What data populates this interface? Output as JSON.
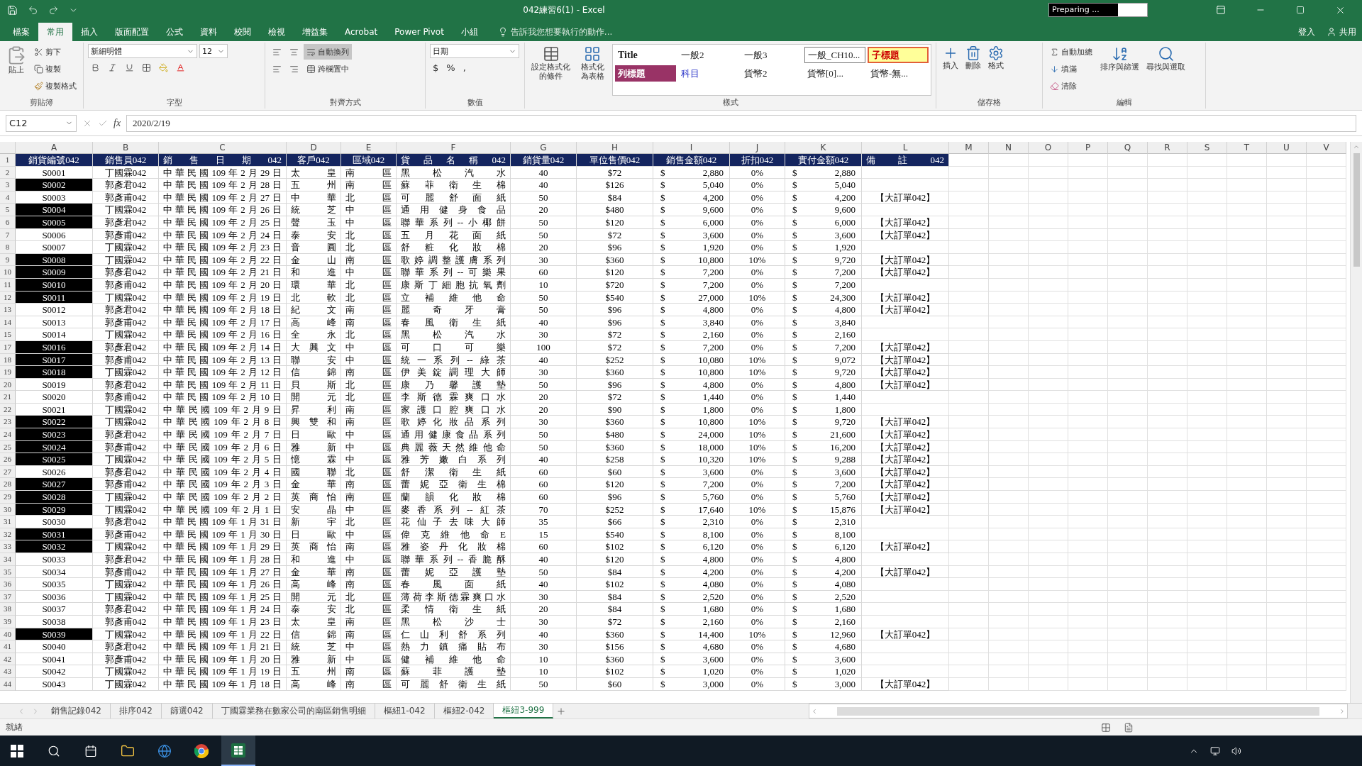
{
  "window": {
    "title": "042練習6(1) - Excel",
    "progress": {
      "label": "Preparing ...",
      "level": 0.7
    }
  },
  "menu_tabs": [
    {
      "label": "檔案",
      "selected": false
    },
    {
      "label": "常用",
      "selected": true
    },
    {
      "label": "插入",
      "selected": false
    },
    {
      "label": "版面配置",
      "selected": false
    },
    {
      "label": "公式",
      "selected": false
    },
    {
      "label": "資料",
      "selected": false
    },
    {
      "label": "校閱",
      "selected": false
    },
    {
      "label": "檢視",
      "selected": false
    },
    {
      "label": "增益集",
      "selected": false
    },
    {
      "label": "Acrobat",
      "selected": false
    },
    {
      "label": "Power Pivot",
      "selected": false
    },
    {
      "label": "小組",
      "selected": false
    }
  ],
  "tell_me": "告訴我您想要執行的動作...",
  "sign_in": "登入",
  "share": "共用",
  "ribbon": {
    "clipboard": {
      "label": "剪貼簿",
      "paste": "貼上",
      "cut": "剪下",
      "copy": "複製",
      "format_painter": "複製格式"
    },
    "font": {
      "label": "字型",
      "name": "新細明體",
      "size": "12"
    },
    "alignment": {
      "label": "對齊方式",
      "wrap": "自動換列",
      "wrap_on": true,
      "merge": "跨欄置中"
    },
    "number": {
      "label": "數值",
      "format": "日期",
      "symbols": [
        "$",
        "%",
        ","
      ]
    },
    "styles": {
      "label": "樣式",
      "conditional": "設定格式化的條件",
      "as_table": "格式化為表格",
      "gallery": [
        {
          "label": "Title",
          "kind": "title"
        },
        {
          "label": "一般2",
          "kind": "plain"
        },
        {
          "label": "一般3",
          "kind": "plain"
        },
        {
          "label": "一般_CH10...",
          "kind": "outlined"
        },
        {
          "label": "子標題",
          "kind": "subtitle"
        },
        {
          "label": "列標題",
          "kind": "header"
        },
        {
          "label": "科目",
          "kind": "subject"
        },
        {
          "label": "貨幣2",
          "kind": "plain"
        },
        {
          "label": "貨幣[0]...",
          "kind": "plain"
        },
        {
          "label": "貨幣-無...",
          "kind": "plain"
        }
      ]
    },
    "cells": {
      "label": "儲存格",
      "buttons": [
        "插入",
        "刪除",
        "格式"
      ]
    },
    "editing": {
      "label": "編輯",
      "autosum": "自動加總",
      "fill": "填滿",
      "clear": "清除",
      "sort": "排序與篩選",
      "find": "尋找與選取"
    }
  },
  "formula_bar": {
    "name_box": "C12",
    "function_label": "fx",
    "value": "2020/2/19"
  },
  "columns": [
    "A",
    "B",
    "C",
    "D",
    "E",
    "F",
    "G",
    "H",
    "I",
    "J",
    "K",
    "L",
    "M",
    "N",
    "O",
    "P",
    "Q",
    "R",
    "S",
    "T",
    "U",
    "V"
  ],
  "header_row_number": "1",
  "headers": [
    "銷貨編號042",
    "銷售員042",
    "銷售日期042",
    "客戶042",
    "區域042",
    "貨品名稱042",
    "銷貨量042",
    "單位售價042",
    "銷售金額042",
    "折扣042",
    "實付金額042",
    "備註042"
  ],
  "rows": [
    {
      "n": "2",
      "id": "S0001",
      "highlighted": false,
      "seller": "丁國霖042",
      "date": "中華民國109年2月29日",
      "customer": "太皇",
      "region": "南區",
      "product": "黑松汽水",
      "qty": "40",
      "price": "$72",
      "amount": [
        "$",
        "2,880"
      ],
      "discount": "0%",
      "paid": [
        "$",
        "2,880"
      ]
    },
    {
      "n": "3",
      "id": "S0002",
      "highlighted": true,
      "seller": "郭彥君042",
      "date": "中華民國109年2月28日",
      "customer": "五州",
      "region": "南區",
      "product": "蘇菲衛生棉",
      "qty": "40",
      "price": "$126",
      "amount": [
        "$",
        "5,040"
      ],
      "discount": "0%",
      "paid": [
        "$",
        "5,040"
      ]
    },
    {
      "n": "4",
      "id": "S0003",
      "highlighted": false,
      "seller": "郭彥甫042",
      "date": "中華民國109年2月27日",
      "customer": "中華",
      "region": "北區",
      "product": "可麗舒面紙",
      "qty": "50",
      "price": "$84",
      "amount": [
        "$",
        "4,200"
      ],
      "discount": "0%",
      "paid": [
        "$",
        "4,200"
      ],
      "note": "【大訂單042】"
    },
    {
      "n": "5",
      "id": "S0004",
      "highlighted": true,
      "seller": "丁國霖042",
      "date": "中華民國109年2月26日",
      "customer": "統芝",
      "region": "中區",
      "product": "通用健身食品",
      "qty": "20",
      "price": "$480",
      "amount": [
        "$",
        "9,600"
      ],
      "discount": "0%",
      "paid": [
        "$",
        "9,600"
      ]
    },
    {
      "n": "6",
      "id": "S0005",
      "highlighted": true,
      "seller": "郭彥君042",
      "date": "中華民國109年2月25日",
      "customer": "聲玉",
      "region": "中區",
      "product": "聯華系列--小椰餅",
      "qty": "50",
      "price": "$120",
      "amount": [
        "$",
        "6,000"
      ],
      "discount": "0%",
      "paid": [
        "$",
        "6,000"
      ],
      "note": "【大訂單042】"
    },
    {
      "n": "7",
      "id": "S0006",
      "highlighted": false,
      "seller": "郭彥甫042",
      "date": "中華民國109年2月24日",
      "customer": "泰安",
      "region": "北區",
      "product": "五月花面紙",
      "qty": "50",
      "price": "$72",
      "amount": [
        "$",
        "3,600"
      ],
      "discount": "0%",
      "paid": [
        "$",
        "3,600"
      ],
      "note": "【大訂單042】"
    },
    {
      "n": "8",
      "id": "S0007",
      "highlighted": false,
      "seller": "丁國霖042",
      "date": "中華民國109年2月23日",
      "customer": "音圓",
      "region": "北區",
      "product": "舒粧化妝棉",
      "qty": "20",
      "price": "$96",
      "amount": [
        "$",
        "1,920"
      ],
      "discount": "0%",
      "paid": [
        "$",
        "1,920"
      ]
    },
    {
      "n": "9",
      "id": "S0008",
      "highlighted": true,
      "seller": "丁國霖042",
      "date": "中華民國109年2月22日",
      "customer": "金山",
      "region": "南區",
      "product": "歌婷調整護膚系列",
      "qty": "30",
      "price": "$360",
      "amount": [
        "$",
        "10,800"
      ],
      "discount": "10%",
      "paid": [
        "$",
        "9,720"
      ],
      "note": "【大訂單042】"
    },
    {
      "n": "10",
      "id": "S0009",
      "highlighted": true,
      "seller": "郭彥君042",
      "date": "中華民國109年2月21日",
      "customer": "和進",
      "region": "中區",
      "product": "聯華系列--可樂果",
      "qty": "60",
      "price": "$120",
      "amount": [
        "$",
        "7,200"
      ],
      "discount": "0%",
      "paid": [
        "$",
        "7,200"
      ],
      "note": "【大訂單042】"
    },
    {
      "n": "11",
      "id": "S0010",
      "highlighted": true,
      "seller": "郭彥甫042",
      "date": "中華民國109年2月20日",
      "customer": "環華",
      "region": "北區",
      "product": "康斯丁細胞抗氧劑",
      "qty": "10",
      "price": "$720",
      "amount": [
        "$",
        "7,200"
      ],
      "discount": "0%",
      "paid": [
        "$",
        "7,200"
      ]
    },
    {
      "n": "12",
      "id": "S0011",
      "highlighted": true,
      "seller": "丁國霖042",
      "date": "中華民國109年2月19日",
      "customer": "北軟",
      "region": "北區",
      "product": "立補維他命",
      "qty": "50",
      "price": "$540",
      "amount": [
        "$",
        "27,000"
      ],
      "discount": "10%",
      "paid": [
        "$",
        "24,300"
      ],
      "note": "【大訂單042】"
    },
    {
      "n": "13",
      "id": "S0012",
      "highlighted": false,
      "seller": "郭彥君042",
      "date": "中華民國109年2月18日",
      "customer": "紀文",
      "region": "南區",
      "product": "麗奇牙膏",
      "qty": "50",
      "price": "$96",
      "amount": [
        "$",
        "4,800"
      ],
      "discount": "0%",
      "paid": [
        "$",
        "4,800"
      ],
      "note": "【大訂單042】"
    },
    {
      "n": "14",
      "id": "S0013",
      "highlighted": false,
      "seller": "郭彥甫042",
      "date": "中華民國109年2月17日",
      "customer": "高峰",
      "region": "南區",
      "product": "春風衛生紙",
      "qty": "40",
      "price": "$96",
      "amount": [
        "$",
        "3,840"
      ],
      "discount": "0%",
      "paid": [
        "$",
        "3,840"
      ]
    },
    {
      "n": "15",
      "id": "S0014",
      "highlighted": false,
      "seller": "丁國霖042",
      "date": "中華民國109年2月16日",
      "customer": "全永",
      "region": "北區",
      "product": "黑松汽水",
      "qty": "30",
      "price": "$72",
      "amount": [
        "$",
        "2,160"
      ],
      "discount": "0%",
      "paid": [
        "$",
        "2,160"
      ]
    },
    {
      "n": "17",
      "id": "S0016",
      "highlighted": true,
      "seller": "郭彥君042",
      "date": "中華民國109年2月14日",
      "customer": "大興文",
      "region": "中區",
      "product": "可口可樂",
      "qty": "100",
      "price": "$72",
      "amount": [
        "$",
        "7,200"
      ],
      "discount": "0%",
      "paid": [
        "$",
        "7,200"
      ],
      "note": "【大訂單042】"
    },
    {
      "n": "18",
      "id": "S0017",
      "highlighted": true,
      "seller": "郭彥甫042",
      "date": "中華民國109年2月13日",
      "customer": "聯安",
      "region": "中區",
      "product": "統一系列--綠茶",
      "qty": "40",
      "price": "$252",
      "amount": [
        "$",
        "10,080"
      ],
      "discount": "10%",
      "paid": [
        "$",
        "9,072"
      ],
      "note": "【大訂單042】"
    },
    {
      "n": "19",
      "id": "S0018",
      "highlighted": true,
      "seller": "丁國霖042",
      "date": "中華民國109年2月12日",
      "customer": "信錦",
      "region": "南區",
      "product": "伊美錠調理大師",
      "qty": "30",
      "price": "$360",
      "amount": [
        "$",
        "10,800"
      ],
      "discount": "10%",
      "paid": [
        "$",
        "9,720"
      ],
      "note": "【大訂單042】"
    },
    {
      "n": "20",
      "id": "S0019",
      "highlighted": false,
      "seller": "郭彥君042",
      "date": "中華民國109年2月11日",
      "customer": "貝斯",
      "region": "北區",
      "product": "康乃馨護墊",
      "qty": "50",
      "price": "$96",
      "amount": [
        "$",
        "4,800"
      ],
      "discount": "0%",
      "paid": [
        "$",
        "4,800"
      ],
      "note": "【大訂單042】"
    },
    {
      "n": "21",
      "id": "S0020",
      "highlighted": false,
      "seller": "郭彥甫042",
      "date": "中華民國109年2月10日",
      "customer": "開元",
      "region": "北區",
      "product": "李斯德霖爽口水",
      "qty": "20",
      "price": "$72",
      "amount": [
        "$",
        "1,440"
      ],
      "discount": "0%",
      "paid": [
        "$",
        "1,440"
      ]
    },
    {
      "n": "22",
      "id": "S0021",
      "highlighted": false,
      "seller": "丁國霖042",
      "date": "中華民國109年2月9日",
      "customer": "昇利",
      "region": "南區",
      "product": "家護口腔爽口水",
      "qty": "20",
      "price": "$90",
      "amount": [
        "$",
        "1,800"
      ],
      "discount": "0%",
      "paid": [
        "$",
        "1,800"
      ]
    },
    {
      "n": "23",
      "id": "S0022",
      "highlighted": true,
      "seller": "丁國霖042",
      "date": "中華民國109年2月8日",
      "customer": "興雙和",
      "region": "南區",
      "product": "歌婷化妝品系列",
      "qty": "30",
      "price": "$360",
      "amount": [
        "$",
        "10,800"
      ],
      "discount": "10%",
      "paid": [
        "$",
        "9,720"
      ],
      "note": "【大訂單042】"
    },
    {
      "n": "24",
      "id": "S0023",
      "highlighted": true,
      "seller": "郭彥君042",
      "date": "中華民國109年2月7日",
      "customer": "日歐",
      "region": "中區",
      "product": "通用健康食品系列",
      "qty": "50",
      "price": "$480",
      "amount": [
        "$",
        "24,000"
      ],
      "discount": "10%",
      "paid": [
        "$",
        "21,600"
      ],
      "note": "【大訂單042】"
    },
    {
      "n": "25",
      "id": "S0024",
      "highlighted": true,
      "seller": "郭彥甫042",
      "date": "中華民國109年2月6日",
      "customer": "雅新",
      "region": "中區",
      "product": "典麗薇天然維他命",
      "qty": "50",
      "price": "$360",
      "amount": [
        "$",
        "18,000"
      ],
      "discount": "10%",
      "paid": [
        "$",
        "16,200"
      ],
      "note": "【大訂單042】"
    },
    {
      "n": "26",
      "id": "S0025",
      "highlighted": true,
      "seller": "丁國霖042",
      "date": "中華民國109年2月5日",
      "customer": "憶霖",
      "region": "中區",
      "product": "雅芳嫩白系列",
      "qty": "40",
      "price": "$258",
      "amount": [
        "$",
        "10,320"
      ],
      "discount": "10%",
      "paid": [
        "$",
        "9,288"
      ],
      "note": "【大訂單042】"
    },
    {
      "n": "27",
      "id": "S0026",
      "highlighted": false,
      "seller": "郭彥君042",
      "date": "中華民國109年2月4日",
      "customer": "國聯",
      "region": "北區",
      "product": "舒潔衛生紙",
      "qty": "60",
      "price": "$60",
      "amount": [
        "$",
        "3,600"
      ],
      "discount": "0%",
      "paid": [
        "$",
        "3,600"
      ],
      "note": "【大訂單042】"
    },
    {
      "n": "28",
      "id": "S0027",
      "highlighted": true,
      "seller": "郭彥甫042",
      "date": "中華民國109年2月3日",
      "customer": "金華",
      "region": "南區",
      "product": "蕾妮亞衛生棉",
      "qty": "60",
      "price": "$120",
      "amount": [
        "$",
        "7,200"
      ],
      "discount": "0%",
      "paid": [
        "$",
        "7,200"
      ],
      "note": "【大訂單042】"
    },
    {
      "n": "29",
      "id": "S0028",
      "highlighted": true,
      "seller": "丁國霖042",
      "date": "中華民國109年2月2日",
      "customer": "英商怡",
      "region": "南區",
      "product": "蘭韻化妝棉",
      "qty": "60",
      "price": "$96",
      "amount": [
        "$",
        "5,760"
      ],
      "discount": "0%",
      "paid": [
        "$",
        "5,760"
      ],
      "note": "【大訂單042】"
    },
    {
      "n": "30",
      "id": "S0029",
      "highlighted": true,
      "seller": "丁國霖042",
      "date": "中華民國109年2月1日",
      "customer": "安晶",
      "region": "中區",
      "product": "麥香系列--紅茶",
      "qty": "70",
      "price": "$252",
      "amount": [
        "$",
        "17,640"
      ],
      "discount": "10%",
      "paid": [
        "$",
        "15,876"
      ],
      "note": "【大訂單042】"
    },
    {
      "n": "31",
      "id": "S0030",
      "highlighted": false,
      "seller": "郭彥君042",
      "date": "中華民國109年1月31日",
      "customer": "新宇",
      "region": "北區",
      "product": "花仙子去味大師",
      "qty": "35",
      "price": "$66",
      "amount": [
        "$",
        "2,310"
      ],
      "discount": "0%",
      "paid": [
        "$",
        "2,310"
      ]
    },
    {
      "n": "32",
      "id": "S0031",
      "highlighted": true,
      "seller": "郭彥甫042",
      "date": "中華民國109年1月30日",
      "customer": "日歐",
      "region": "中區",
      "product": "偉克維他命E",
      "qty": "15",
      "price": "$540",
      "amount": [
        "$",
        "8,100"
      ],
      "discount": "0%",
      "paid": [
        "$",
        "8,100"
      ]
    },
    {
      "n": "33",
      "id": "S0032",
      "highlighted": true,
      "seller": "丁國霖042",
      "date": "中華民國109年1月29日",
      "customer": "英商怡",
      "region": "南區",
      "product": "雅姿丹化妝棉",
      "qty": "60",
      "price": "$102",
      "amount": [
        "$",
        "6,120"
      ],
      "discount": "0%",
      "paid": [
        "$",
        "6,120"
      ],
      "note": "【大訂單042】"
    },
    {
      "n": "34",
      "id": "S0033",
      "highlighted": false,
      "seller": "郭彥君042",
      "date": "中華民國109年1月28日",
      "customer": "和進",
      "region": "中區",
      "product": "聯華系列--香脆酥",
      "qty": "40",
      "price": "$120",
      "amount": [
        "$",
        "4,800"
      ],
      "discount": "0%",
      "paid": [
        "$",
        "4,800"
      ]
    },
    {
      "n": "35",
      "id": "S0034",
      "highlighted": false,
      "seller": "郭彥甫042",
      "date": "中華民國109年1月27日",
      "customer": "金華",
      "region": "南區",
      "product": "蕾妮亞護墊",
      "qty": "50",
      "price": "$84",
      "amount": [
        "$",
        "4,200"
      ],
      "discount": "0%",
      "paid": [
        "$",
        "4,200"
      ],
      "note": "【大訂單042】"
    },
    {
      "n": "36",
      "id": "S0035",
      "highlighted": false,
      "seller": "丁國霖042",
      "date": "中華民國109年1月26日",
      "customer": "高峰",
      "region": "南區",
      "product": "春風面紙",
      "qty": "40",
      "price": "$102",
      "amount": [
        "$",
        "4,080"
      ],
      "discount": "0%",
      "paid": [
        "$",
        "4,080"
      ]
    },
    {
      "n": "37",
      "id": "S0036",
      "highlighted": false,
      "seller": "丁國霖042",
      "date": "中華民國109年1月25日",
      "customer": "開元",
      "region": "北區",
      "product": "薄荷李斯德霖爽口水",
      "qty": "30",
      "price": "$84",
      "amount": [
        "$",
        "2,520"
      ],
      "discount": "0%",
      "paid": [
        "$",
        "2,520"
      ]
    },
    {
      "n": "38",
      "id": "S0037",
      "highlighted": false,
      "seller": "郭彥君042",
      "date": "中華民國109年1月24日",
      "customer": "泰安",
      "region": "北區",
      "product": "柔情衛生紙",
      "qty": "20",
      "price": "$84",
      "amount": [
        "$",
        "1,680"
      ],
      "discount": "0%",
      "paid": [
        "$",
        "1,680"
      ]
    },
    {
      "n": "39",
      "id": "S0038",
      "highlighted": false,
      "seller": "郭彥甫042",
      "date": "中華民國109年1月23日",
      "customer": "太皇",
      "region": "南區",
      "product": "黑松沙士",
      "qty": "30",
      "price": "$72",
      "amount": [
        "$",
        "2,160"
      ],
      "discount": "0%",
      "paid": [
        "$",
        "2,160"
      ]
    },
    {
      "n": "40",
      "id": "S0039",
      "highlighted": true,
      "seller": "丁國霖042",
      "date": "中華民國109年1月22日",
      "customer": "信錦",
      "region": "南區",
      "product": "仁山利舒系列",
      "qty": "40",
      "price": "$360",
      "amount": [
        "$",
        "14,400"
      ],
      "discount": "10%",
      "paid": [
        "$",
        "12,960"
      ],
      "note": "【大訂單042】"
    },
    {
      "n": "41",
      "id": "S0040",
      "highlighted": false,
      "seller": "郭彥君042",
      "date": "中華民國109年1月21日",
      "customer": "統芝",
      "region": "中區",
      "product": "熱力鎮痛貼布",
      "qty": "30",
      "price": "$156",
      "amount": [
        "$",
        "4,680"
      ],
      "discount": "0%",
      "paid": [
        "$",
        "4,680"
      ]
    },
    {
      "n": "42",
      "id": "S0041",
      "highlighted": false,
      "seller": "郭彥甫042",
      "date": "中華民國109年1月20日",
      "customer": "雅新",
      "region": "中區",
      "product": "健補維他命",
      "qty": "10",
      "price": "$360",
      "amount": [
        "$",
        "3,600"
      ],
      "discount": "0%",
      "paid": [
        "$",
        "3,600"
      ]
    },
    {
      "n": "43",
      "id": "S0042",
      "highlighted": false,
      "seller": "丁國霖042",
      "date": "中華民國109年1月19日",
      "customer": "五州",
      "region": "南區",
      "product": "蘇菲護墊",
      "qty": "10",
      "price": "$102",
      "amount": [
        "$",
        "1,020"
      ],
      "discount": "0%",
      "paid": [
        "$",
        "1,020"
      ]
    },
    {
      "n": "44",
      "id": "S0043",
      "highlighted": false,
      "seller": "丁國霖042",
      "date": "中華民國109年1月18日",
      "customer": "高峰",
      "region": "南區",
      "product": "可麗舒衛生紙",
      "qty": "50",
      "price": "$60",
      "amount": [
        "$",
        "3,000"
      ],
      "discount": "0%",
      "paid": [
        "$",
        "3,000"
      ],
      "note": "【大訂單042】"
    }
  ],
  "sheet_tabs": [
    {
      "label": "銷售記錄042",
      "selected": false
    },
    {
      "label": "排序042",
      "selected": false
    },
    {
      "label": "篩選042",
      "selected": false
    },
    {
      "label": "丁國霖業務在數家公司的南區銷售明細",
      "selected": false
    },
    {
      "label": "樞紐1-042",
      "selected": false
    },
    {
      "label": "樞紐2-042",
      "selected": false
    },
    {
      "label": "樞紐3-999",
      "selected": true
    }
  ],
  "status_bar": {
    "text": "就緒"
  }
}
